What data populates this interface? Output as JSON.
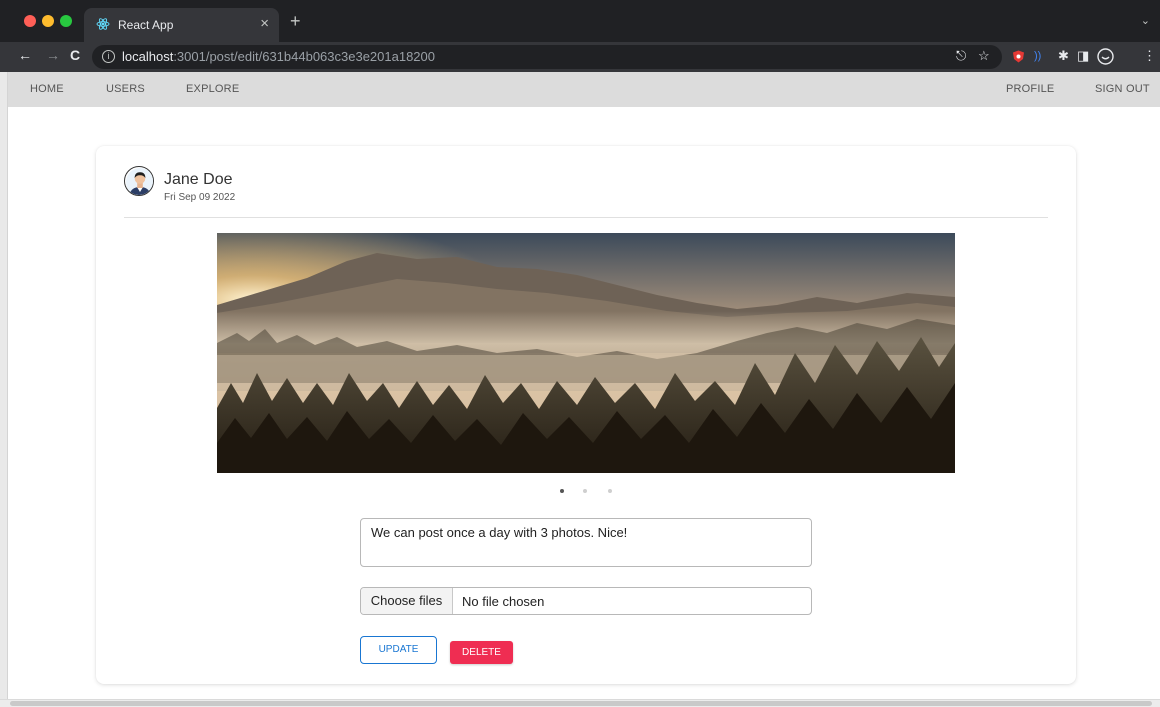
{
  "browser": {
    "tab_title": "React App",
    "tab_close": "×",
    "new_tab": "+",
    "url_host": "localhost",
    "url_path": ":3001/post/edit/631b44b063c3e3e201a18200"
  },
  "nav": {
    "home": "HOME",
    "users": "USERS",
    "explore": "EXPLORE",
    "profile": "PROFILE",
    "sign_out": "SIGN OUT"
  },
  "post": {
    "author": "Jane Doe",
    "date": "Fri Sep 09 2022",
    "photo_count": 3,
    "active_photo": 1,
    "caption": "We can post once a day with 3 photos. Nice!",
    "file_button": "Choose files",
    "file_status": "No file chosen",
    "update_label": "UPDATE",
    "delete_label": "DELETE"
  },
  "colors": {
    "update_accent": "#1976d2",
    "delete_bg": "#ef2d52",
    "nav_bg": "#dcdcdc"
  }
}
